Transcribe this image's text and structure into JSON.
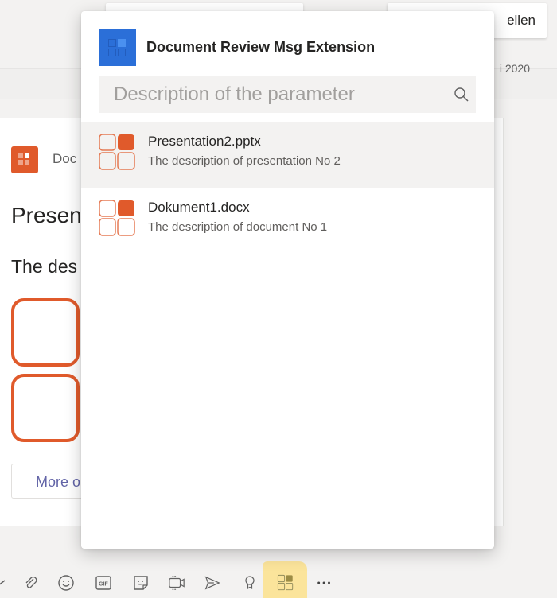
{
  "header": {
    "right_button_label": "ellen",
    "date_text": "i 2020"
  },
  "card": {
    "app_name": "Doc",
    "title": "Presen",
    "description": "The des",
    "more_button_label": "More o"
  },
  "popup": {
    "title": "Document Review Msg Extension",
    "search": {
      "placeholder": "Description of the parameter",
      "value": ""
    },
    "results": [
      {
        "name": "Presentation2.pptx",
        "description": "The description of presentation No 2",
        "hovered": true
      },
      {
        "name": "Dokument1.docx",
        "description": "The description of document No 1",
        "hovered": false
      }
    ]
  },
  "toolbar": {
    "icons": [
      "format-icon",
      "attach-icon",
      "emoji-icon",
      "gif-icon",
      "sticker-icon",
      "meet-now-icon",
      "send-icon",
      "praise-icon",
      "document-review-extension-icon",
      "more-options-icon"
    ],
    "active": "document-review-extension-icon"
  },
  "colors": {
    "accent_orange": "#e05a2b",
    "extension_blue": "#2b6fd8",
    "teams_purple": "#6264a7",
    "highlight_yellow": "#fbe49b"
  }
}
